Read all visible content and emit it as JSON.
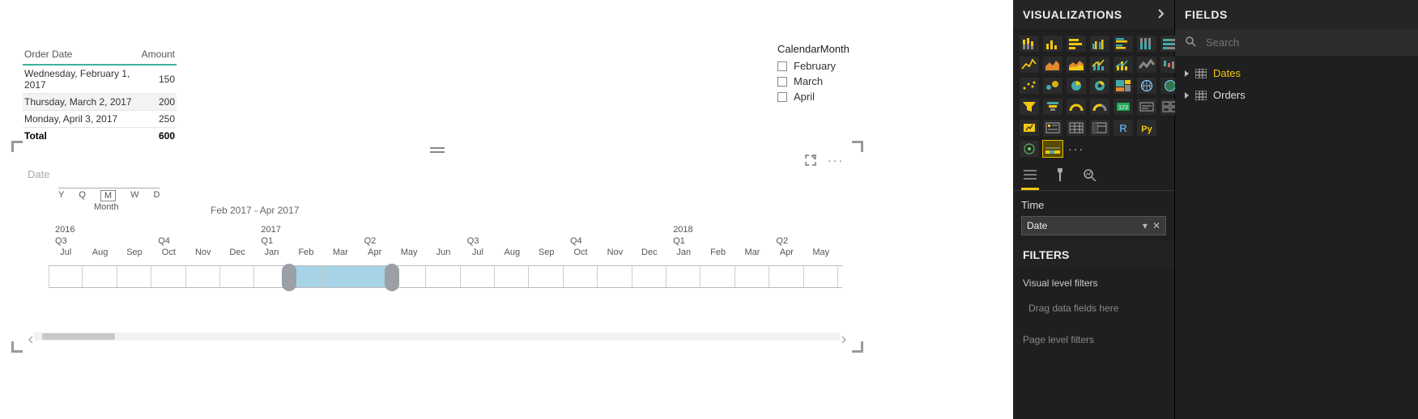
{
  "table": {
    "headers": {
      "date": "Order Date",
      "amount": "Amount"
    },
    "rows": [
      {
        "date": "Wednesday, February 1, 2017",
        "amount": "150"
      },
      {
        "date": "Thursday, March 2, 2017",
        "amount": "200"
      },
      {
        "date": "Monday, April 3, 2017",
        "amount": "250"
      }
    ],
    "total_label": "Total",
    "total_amount": "600"
  },
  "slicer": {
    "title": "CalendarMonth",
    "items": [
      "February",
      "March",
      "April"
    ]
  },
  "timeline": {
    "title": "Date",
    "granularity": {
      "options": [
        "Y",
        "Q",
        "M",
        "W",
        "D"
      ],
      "active": "M",
      "label": "Month"
    },
    "range_text": "Feb 2017 - Apr 2017",
    "years": [
      "2016",
      "2017",
      "2018"
    ],
    "quarters": [
      "Q3",
      "Q4",
      "Q1",
      "Q2",
      "Q3",
      "Q4",
      "Q1",
      "Q2"
    ],
    "months": [
      "Jul",
      "Aug",
      "Sep",
      "Oct",
      "Nov",
      "Dec",
      "Jan",
      "Feb",
      "Mar",
      "Apr",
      "May",
      "Jun",
      "Jul",
      "Aug",
      "Sep",
      "Oct",
      "Nov",
      "Dec",
      "Jan",
      "Feb",
      "Mar",
      "Apr",
      "May"
    ],
    "selected_start_index": 7,
    "selected_end_index": 9
  },
  "viz_panel": {
    "title": "VISUALIZATIONS",
    "well": {
      "label": "Time",
      "chip": "Date"
    },
    "filters_title": "FILTERS",
    "visual_filters_label": "Visual level filters",
    "drop_hint": "Drag data fields here",
    "page_filters_label": "Page level filters"
  },
  "fields_panel": {
    "title": "FIELDS",
    "search_placeholder": "Search",
    "tables": [
      {
        "name": "Dates",
        "active": true
      },
      {
        "name": "Orders",
        "active": false
      }
    ]
  },
  "viz_gallery": {
    "rows": [
      [
        "bar-stacked",
        "column",
        "bar-h",
        "column-cluster",
        "bar-cluster",
        "column-100",
        "bar-100"
      ],
      [
        "line",
        "area",
        "area-stacked",
        "line-column",
        "column-line",
        "ribbon",
        "waterfall"
      ],
      [
        "scatter",
        "bubble",
        "pie",
        "donut",
        "treemap",
        "map",
        "filled-map"
      ],
      [
        "funnel-h",
        "funnel",
        "gauge",
        "gauge2",
        "kpi",
        "card",
        "multi-card"
      ],
      [
        "kpi-box",
        "slicer",
        "table",
        "matrix",
        "r-visual",
        "py-visual",
        ""
      ],
      [
        "arcgis",
        "timeline",
        "ellipsis",
        "",
        "",
        "",
        ""
      ]
    ],
    "selected": "timeline"
  }
}
